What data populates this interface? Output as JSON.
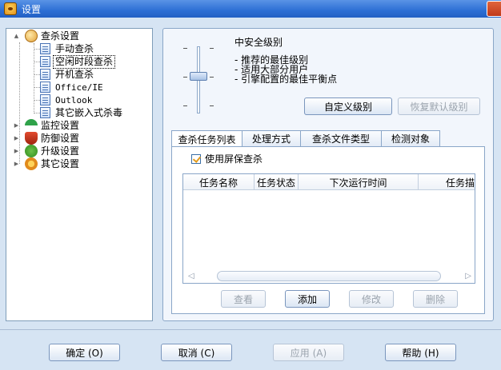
{
  "window": {
    "title": "设置"
  },
  "tree": {
    "root": {
      "label": "查杀设置"
    },
    "children": [
      {
        "label": "手动查杀"
      },
      {
        "label": "空闲时段查杀",
        "selected": true
      },
      {
        "label": "开机查杀"
      },
      {
        "label": "Office/IE"
      },
      {
        "label": "Outlook"
      },
      {
        "label": "其它嵌入式杀毒"
      }
    ],
    "categories": [
      {
        "label": "监控设置",
        "icon": "umbrella-icon"
      },
      {
        "label": "防御设置",
        "icon": "shield-icon"
      },
      {
        "label": "升级设置",
        "icon": "upgrade-icon"
      },
      {
        "label": "其它设置",
        "icon": "gear-icon"
      }
    ]
  },
  "security_level": {
    "title": "中安全级别",
    "descriptions": [
      "- 推荐的最佳级别",
      "- 适用大部分用户",
      "- 引擎配置的最佳平衡点"
    ],
    "custom_button": "自定义级别",
    "restore_button": "恢复默认级别",
    "level": 2,
    "levels": 4
  },
  "tabs": [
    {
      "label": "查杀任务列表",
      "active": true
    },
    {
      "label": "处理方式"
    },
    {
      "label": "查杀文件类型"
    },
    {
      "label": "检测对象"
    }
  ],
  "screensaver": {
    "label": "使用屏保查杀",
    "checked": true
  },
  "task_list": {
    "columns": [
      "任务名称",
      "任务状态",
      "下次运行时间",
      "任务描"
    ],
    "rows": []
  },
  "task_buttons": {
    "view": "查看",
    "add": "添加",
    "edit": "修改",
    "delete": "删除"
  },
  "footer": {
    "ok": "确定 (O)",
    "cancel": "取消 (C)",
    "apply": "应用 (A)",
    "help": "帮助 (H)"
  },
  "colors": {
    "titlebar": "#2d6fd4",
    "background": "#d6e4f3",
    "panel": "#f2f6fc"
  }
}
